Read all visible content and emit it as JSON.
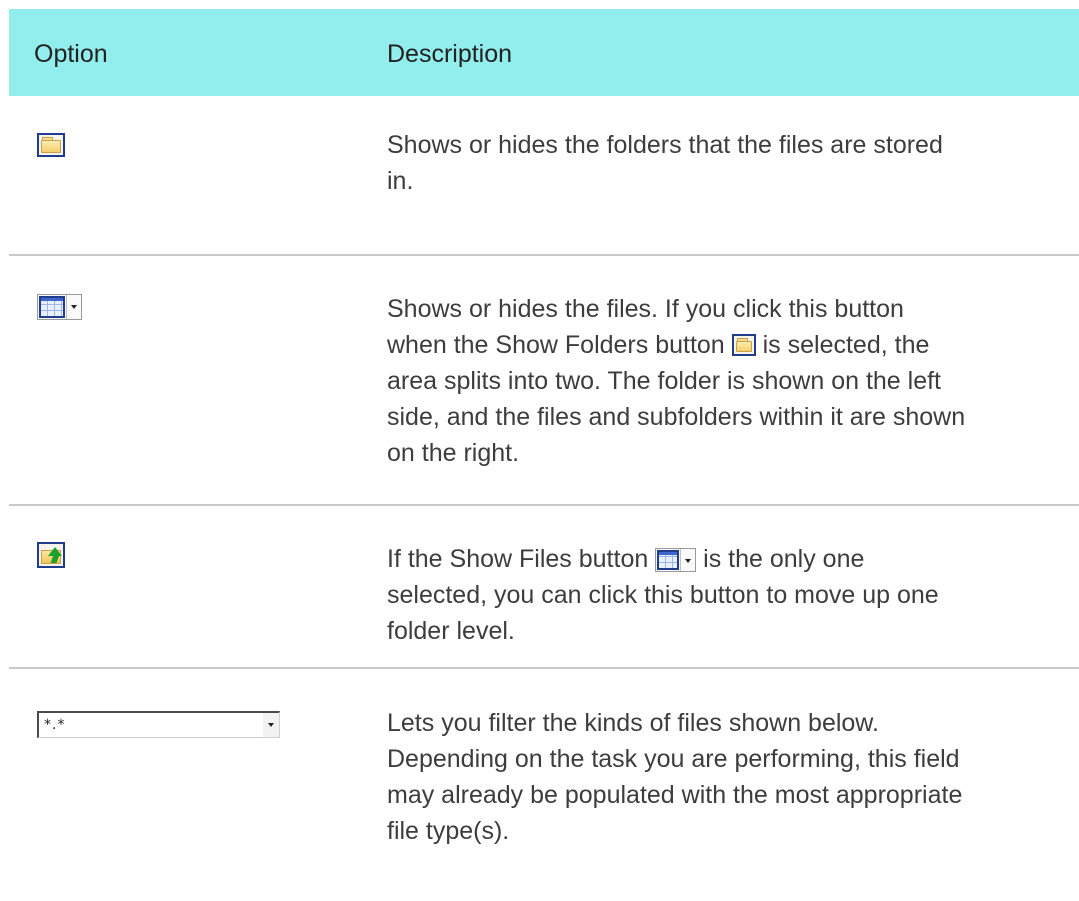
{
  "header": {
    "option": "Option",
    "description": "Description"
  },
  "rows": [
    {
      "icon": "folder-icon",
      "description": [
        "Shows or hides the folders that the files are stored",
        "in."
      ]
    },
    {
      "icon": "show-files-icon",
      "description_lines": [
        "Shows or hides the files. If you click this button",
        "when the Show Folders button",
        "is selected, the",
        "area splits into two. The folder is shown on the left",
        "side, and the files and subfolders within it are shown",
        "on the right."
      ]
    },
    {
      "icon": "folder-up-icon",
      "description_lines": [
        "If the Show Files button",
        "is the only one",
        "selected, you can click this button to move up one",
        "folder level."
      ]
    },
    {
      "icon": "filter-dropdown",
      "filter_value": "*.*",
      "description": [
        "Lets you filter the kinds of files shown below.",
        "Depending on the task you are performing, this field",
        "may already be populated with the most appropriate",
        "file type(s)."
      ]
    }
  ],
  "colors": {
    "header_background": "#92eeec",
    "divider": "#c9c9c9",
    "text": "#3d3d3d"
  }
}
